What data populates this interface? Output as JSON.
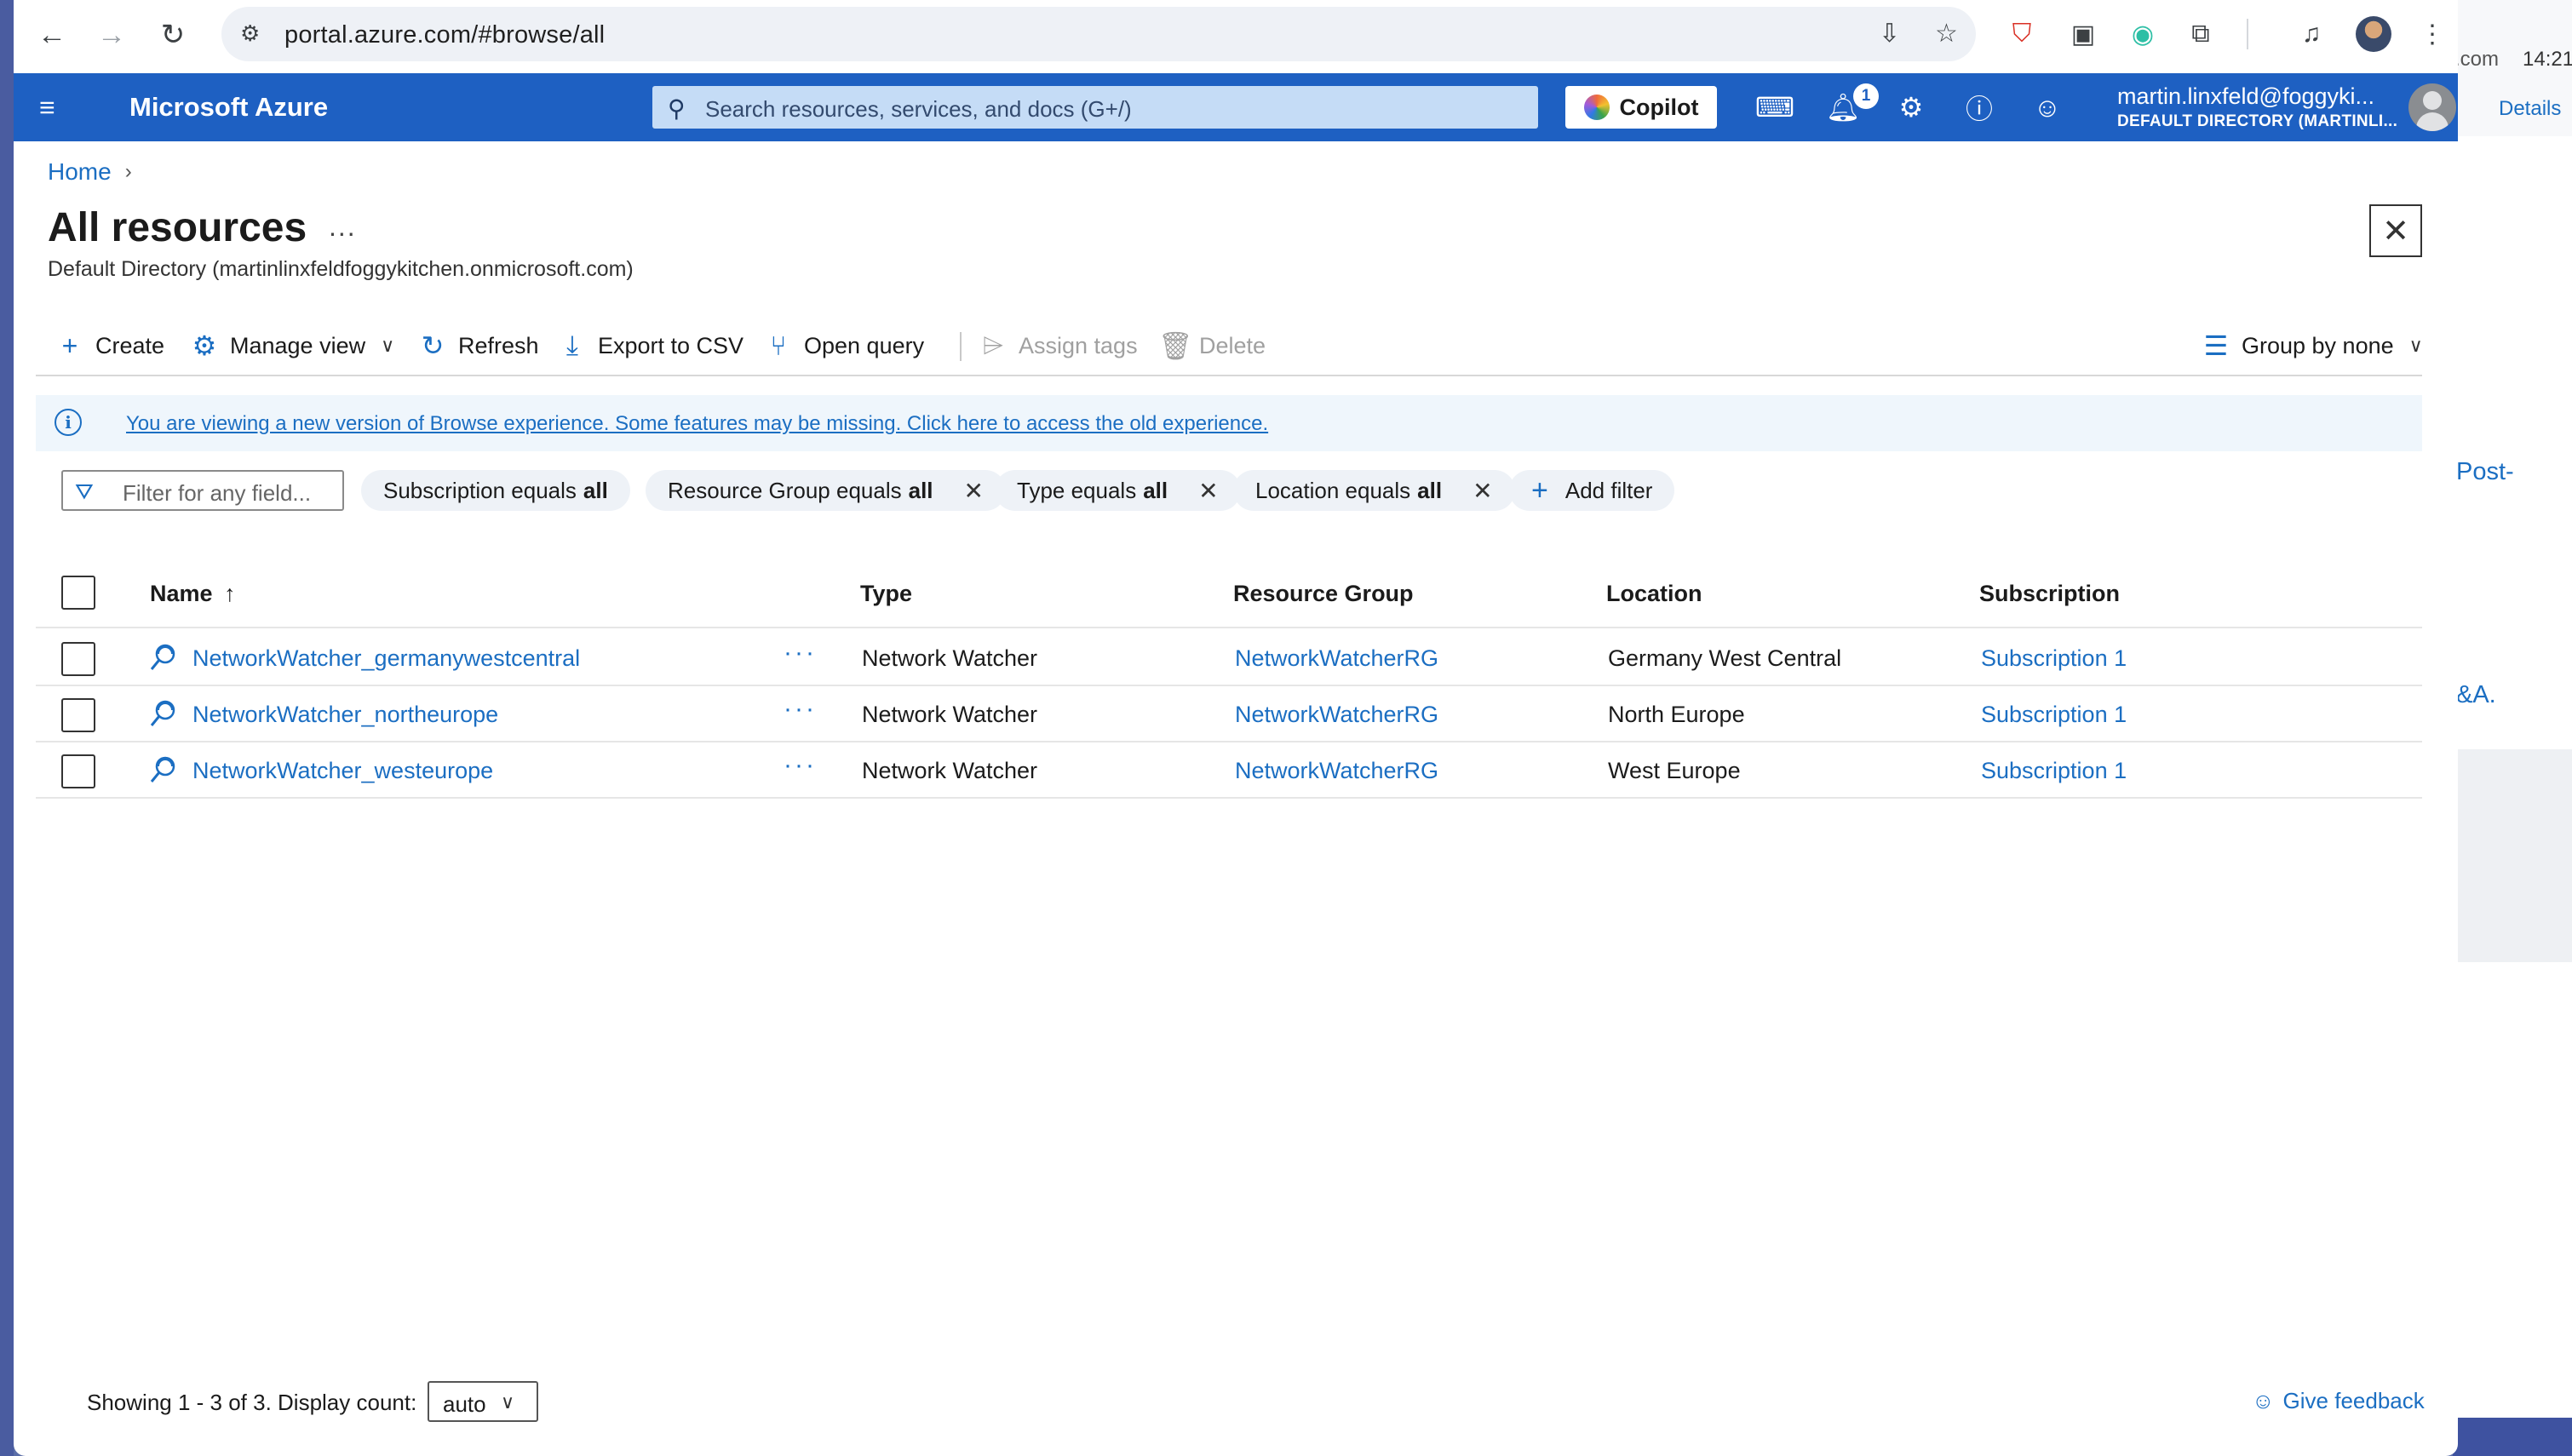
{
  "browser": {
    "url": "portal.azure.com/#browse/all"
  },
  "azure": {
    "brand": "Microsoft Azure",
    "search_placeholder": "Search resources, services, and docs (G+/)",
    "copilot_label": "Copilot",
    "notification_count": "1",
    "account_email": "martin.linxfeld@foggyki...",
    "account_directory": "DEFAULT DIRECTORY (MARTINLI..."
  },
  "breadcrumb": {
    "home": "Home",
    "separator": "›"
  },
  "page": {
    "title": "All resources",
    "more": "...",
    "subtitle": "Default Directory (martinlinxfeldfoggykitchen.onmicrosoft.com)"
  },
  "toolbar": {
    "create": "Create",
    "manage_view": "Manage view",
    "refresh": "Refresh",
    "export_csv": "Export to CSV",
    "open_query": "Open query",
    "assign_tags": "Assign tags",
    "delete": "Delete",
    "group_by": "Group by none"
  },
  "banner": {
    "message": "You are viewing a new version of Browse experience. Some features may be missing. Click here to access the old experience."
  },
  "filters": {
    "placeholder": "Filter for any field...",
    "pills": [
      {
        "label": "Subscription equals",
        "value": "all"
      },
      {
        "label": "Resource Group equals",
        "value": "all"
      },
      {
        "label": "Type equals",
        "value": "all"
      },
      {
        "label": "Location equals",
        "value": "all"
      }
    ],
    "add_filter": "Add filter"
  },
  "table": {
    "columns": {
      "name": "Name",
      "sort_indicator": "↑",
      "type": "Type",
      "resource_group": "Resource Group",
      "location": "Location",
      "subscription": "Subscription"
    },
    "rows": [
      {
        "name": "NetworkWatcher_germanywestcentral",
        "type": "Network Watcher",
        "resource_group": "NetworkWatcherRG",
        "location": "Germany West Central",
        "subscription": "Subscription 1"
      },
      {
        "name": "NetworkWatcher_northeurope",
        "type": "Network Watcher",
        "resource_group": "NetworkWatcherRG",
        "location": "North Europe",
        "subscription": "Subscription 1"
      },
      {
        "name": "NetworkWatcher_westeurope",
        "type": "Network Watcher",
        "resource_group": "NetworkWatcherRG",
        "location": "West Europe",
        "subscription": "Subscription 1"
      }
    ],
    "row_more": "···"
  },
  "footer": {
    "showing": "Showing 1 - 3 of 3. Display count:",
    "display_count": "auto",
    "feedback": "Give feedback"
  },
  "background_window": {
    "com": ".com",
    "time": "14:21",
    "details": "Details",
    "post": "Post-",
    "qa": "&A."
  },
  "colors": {
    "azure_header": "#1e60c2",
    "link": "#1b6ec2",
    "banner_bg": "#eff6fc"
  }
}
